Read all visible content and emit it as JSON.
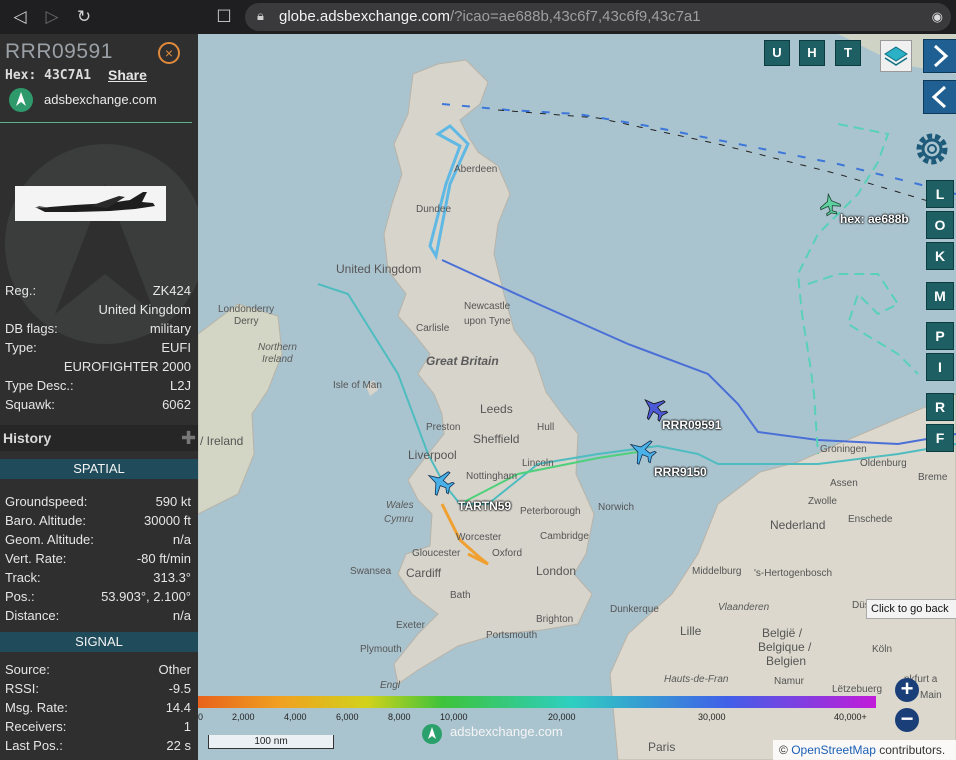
{
  "browser": {
    "url_domain": "globe.adsbexchange.com",
    "url_path": "/?icao=ae688b,43c6f7,43c6f9,43c7a1"
  },
  "sidebar": {
    "callsign": "RRR09591",
    "hex_label": "Hex:",
    "hex_value": "43C7A1",
    "share_label": "Share",
    "site": "adsbexchange.com",
    "details": [
      {
        "label": "Reg.:",
        "value": "ZK424"
      },
      {
        "label": "",
        "value": "United Kingdom"
      },
      {
        "label": "DB flags:",
        "value": "military"
      },
      {
        "label": "Type:",
        "value": "EUFI"
      },
      {
        "label": "",
        "value": "EUROFIGHTER 2000"
      },
      {
        "label": "Type Desc.:",
        "value": "L2J"
      },
      {
        "label": "Squawk:",
        "value": "6062"
      }
    ],
    "history_title": "History",
    "spatial_title": "SPATIAL",
    "spatial": [
      {
        "label": "Groundspeed:",
        "value": "590 kt"
      },
      {
        "label": "Baro. Altitude:",
        "value": "30000 ft"
      },
      {
        "label": "Geom. Altitude:",
        "value": "n/a"
      },
      {
        "label": "Vert. Rate:",
        "value": "-80 ft/min"
      },
      {
        "label": "Track:",
        "value": "313.3°"
      },
      {
        "label": "Pos.:",
        "value": "53.903°, 2.100°"
      },
      {
        "label": "Distance:",
        "value": "n/a"
      }
    ],
    "signal_title": "SIGNAL",
    "signal": [
      {
        "label": "Source:",
        "value": "Other"
      },
      {
        "label": "RSSI:",
        "value": "-9.5"
      },
      {
        "label": "Msg. Rate:",
        "value": "14.4"
      },
      {
        "label": "Receivers:",
        "value": "1"
      },
      {
        "label": "Last Pos.:",
        "value": "22 s"
      }
    ]
  },
  "map": {
    "top_buttons": [
      "U",
      "H",
      "T"
    ],
    "side_buttons": [
      "L",
      "O",
      "K",
      "M",
      "P",
      "I",
      "R",
      "F"
    ],
    "aircraft_labels": {
      "rrr09591": "RRR09591",
      "rrr9150": "RRR9150",
      "tartn59": "TARTN59",
      "ae688b": "hex: ae688b"
    },
    "places": {
      "united_kingdom": "United Kingdom",
      "great_britain": "Great Britain",
      "isle_of_man": "Isle of Man",
      "ireland": "/ Ireland",
      "dundee": "Dundee",
      "aberdeen": "Aberdeen",
      "newcastle": "Newcastle",
      "upon_tyne": "upon Tyne",
      "carlisle": "Carlisle",
      "londonderry": "Londonderry",
      "derry": "Derry",
      "northern": "Northern",
      "ireland_ni": "Ireland",
      "leeds": "Leeds",
      "preston": "Preston",
      "liverpool": "Liverpool",
      "sheffield": "Sheffield",
      "hull": "Hull",
      "lincoln": "Lincoln",
      "nottingham": "Nottingham",
      "peterborough": "Peterborough",
      "norwich": "Norwich",
      "wales": "Wales",
      "cymru": "Cymru",
      "worcester": "Worcester",
      "gloucester": "Gloucester",
      "oxford": "Oxford",
      "cambridge": "Cambridge",
      "london": "London",
      "swansea": "Swansea",
      "cardiff": "Cardiff",
      "bath": "Bath",
      "exeter": "Exeter",
      "brighton": "Brighton",
      "portsmouth": "Portsmouth",
      "plymouth": "Plymouth",
      "dunkerque": "Dunkerque",
      "lille": "Lille",
      "middelburg": "Middelburg",
      "hertogenbosch": "'s-Hertogenbosch",
      "vlaanderen": "Vlaanderen",
      "belgie": "België /",
      "belgique": "Belgique /",
      "belgien": "Belgien",
      "nederland": "Nederland",
      "groningen": "Groningen",
      "oldenburg": "Oldenburg",
      "assen": "Assen",
      "zwolle": "Zwolle",
      "bremen": "Breme",
      "enschede": "Enschede",
      "dusseldorf": "Düsseldo",
      "koln": "Köln",
      "letzebuerg": "Lëtzebuerg",
      "paris": "Paris",
      "frankfurt": "nkfurt a",
      "main": "Main",
      "namur": "Namur",
      "hauts_de_france": "Hauts-de-Fran",
      "england": "Engl"
    },
    "tooltip": "Click to go back",
    "colorbar_labels": [
      "0",
      "2,000",
      "4,000",
      "6,000",
      "8,000",
      "10,000",
      "20,000",
      "30,000",
      "40,000+"
    ],
    "scale_label": "100 nm",
    "watermark": "adsbexchange.com",
    "attribution_prefix": "© ",
    "attribution_link": "OpenStreetMap",
    "attribution_suffix": " contributors."
  }
}
